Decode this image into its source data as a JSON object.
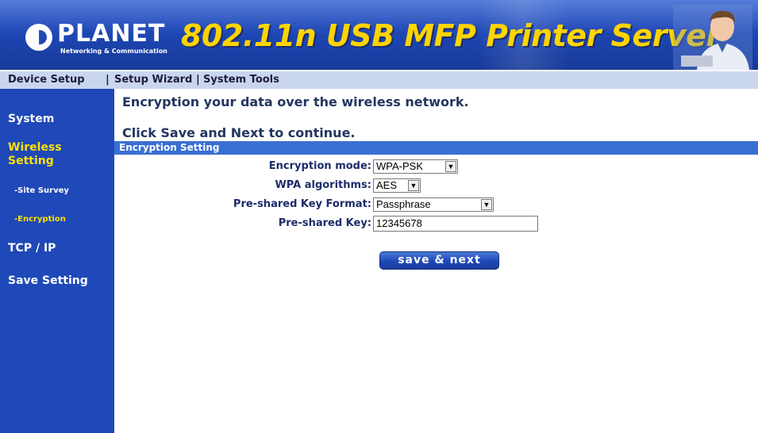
{
  "header": {
    "logo_text": "PLANET",
    "logo_subtext": "Networking & Communication",
    "title": "802.11n USB MFP Printer Server"
  },
  "nav": {
    "items": [
      {
        "label": "Device Setup"
      },
      {
        "label": "Setup Wizard"
      },
      {
        "label": "System Tools"
      }
    ],
    "separator": "|"
  },
  "sidebar": {
    "items": [
      {
        "label": "System",
        "active": false
      },
      {
        "label": "Wireless",
        "active": true
      },
      {
        "label": "Setting",
        "active": true
      },
      {
        "label": "-Site Survey",
        "active": false
      },
      {
        "label": "-Encryption",
        "active": true
      },
      {
        "label": "TCP / IP",
        "active": false
      },
      {
        "label": "Save Setting",
        "active": false
      }
    ]
  },
  "main": {
    "intro": "Encryption your data over the wireless network.",
    "instruction": "Click Save and Next to continue.",
    "section_title": "Encryption Setting",
    "fields": {
      "encryption_mode": {
        "label": "Encryption mode:",
        "value": "WPA-PSK"
      },
      "wpa_algorithms": {
        "label": "WPA algorithms:",
        "value": "AES"
      },
      "key_format": {
        "label": "Pre-shared Key Format:",
        "value": "Passphrase"
      },
      "key": {
        "label": "Pre-shared Key:",
        "value": "12345678"
      }
    },
    "save_button": "save & next"
  },
  "colors": {
    "banner": "#1f48b8",
    "title_yellow": "#ffd400",
    "sidebar": "#1f48b8",
    "sidebar_active": "#ffe100",
    "navbar": "#c9d6ee",
    "section_bar": "#3a6fd2"
  }
}
